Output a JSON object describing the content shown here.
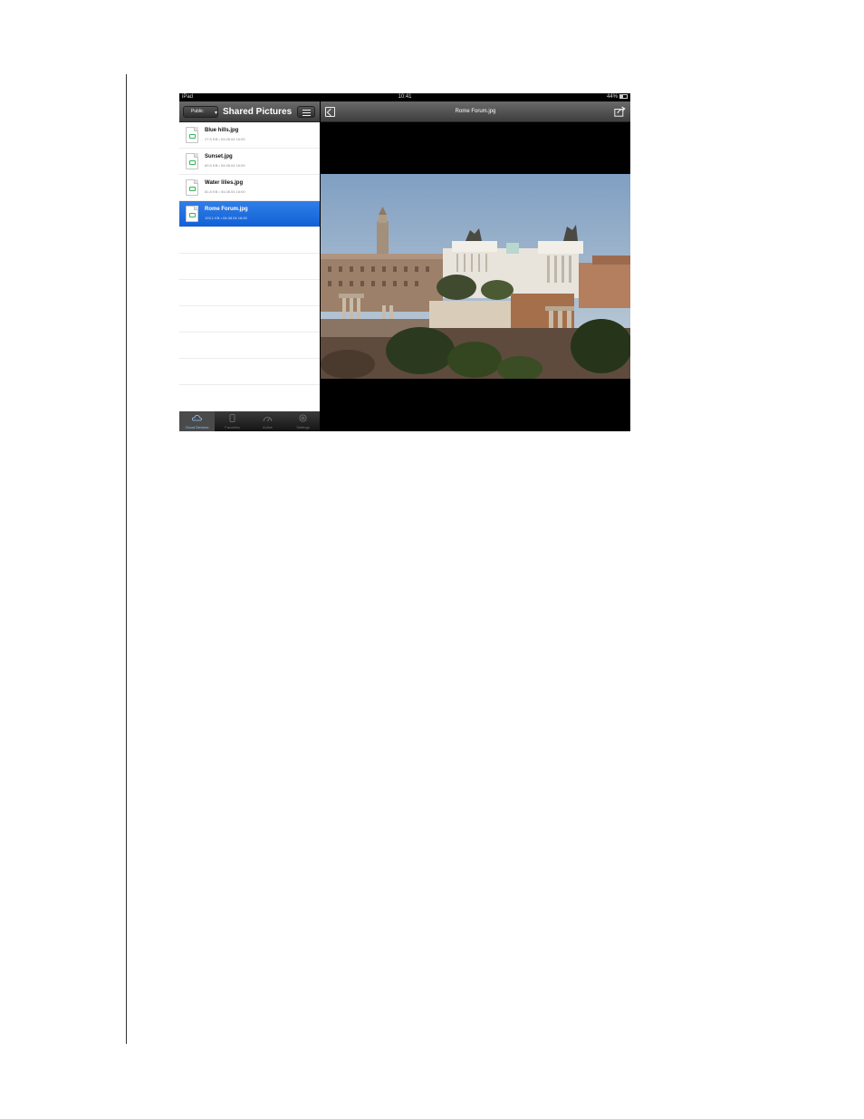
{
  "status_bar": {
    "device": "iPad",
    "time": "10:41",
    "battery": "44%"
  },
  "left_toolbar": {
    "share_label": "Public",
    "title": "Shared Pictures"
  },
  "files": [
    {
      "name": "Blue hills.jpg",
      "meta": "27.5 KB • 04.08.04 16:00",
      "selected": false
    },
    {
      "name": "Sunset.jpg",
      "meta": "69.5 KB • 04.08.04 16:00",
      "selected": false
    },
    {
      "name": "Water lilies.jpg",
      "meta": "81.8 KB • 04.08.04 16:00",
      "selected": false
    },
    {
      "name": "Rome Forum.jpg",
      "meta": "103.1 KB • 04.08.04 16:00",
      "selected": true
    }
  ],
  "tab_bar": {
    "tabs": [
      {
        "label": "Cloud Devices",
        "icon": "cloud-icon",
        "active": true
      },
      {
        "label": "Favorites",
        "icon": "device-icon",
        "active": false
      },
      {
        "label": "Active",
        "icon": "gauge-icon",
        "active": false
      },
      {
        "label": "Settings",
        "icon": "gear-icon",
        "active": false
      }
    ]
  },
  "viewer": {
    "title": "Rome Forum.jpg"
  },
  "colors": {
    "selection": "#1a6ae0",
    "toolbar": "#4e4e4e",
    "file_icon": "#38b35a"
  }
}
